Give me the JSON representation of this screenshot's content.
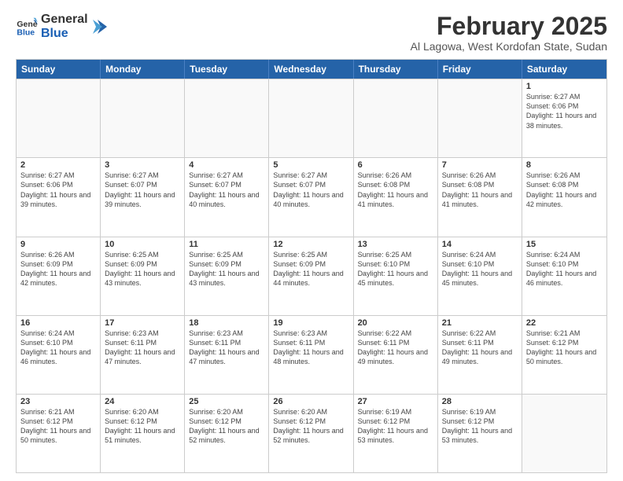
{
  "logo": {
    "line1": "General",
    "line2": "Blue"
  },
  "title": "February 2025",
  "subtitle": "Al Lagowa, West Kordofan State, Sudan",
  "header": {
    "days": [
      "Sunday",
      "Monday",
      "Tuesday",
      "Wednesday",
      "Thursday",
      "Friday",
      "Saturday"
    ]
  },
  "weeks": [
    [
      {
        "day": "",
        "text": ""
      },
      {
        "day": "",
        "text": ""
      },
      {
        "day": "",
        "text": ""
      },
      {
        "day": "",
        "text": ""
      },
      {
        "day": "",
        "text": ""
      },
      {
        "day": "",
        "text": ""
      },
      {
        "day": "1",
        "text": "Sunrise: 6:27 AM\nSunset: 6:06 PM\nDaylight: 11 hours and 38 minutes."
      }
    ],
    [
      {
        "day": "2",
        "text": "Sunrise: 6:27 AM\nSunset: 6:06 PM\nDaylight: 11 hours and 39 minutes."
      },
      {
        "day": "3",
        "text": "Sunrise: 6:27 AM\nSunset: 6:07 PM\nDaylight: 11 hours and 39 minutes."
      },
      {
        "day": "4",
        "text": "Sunrise: 6:27 AM\nSunset: 6:07 PM\nDaylight: 11 hours and 40 minutes."
      },
      {
        "day": "5",
        "text": "Sunrise: 6:27 AM\nSunset: 6:07 PM\nDaylight: 11 hours and 40 minutes."
      },
      {
        "day": "6",
        "text": "Sunrise: 6:26 AM\nSunset: 6:08 PM\nDaylight: 11 hours and 41 minutes."
      },
      {
        "day": "7",
        "text": "Sunrise: 6:26 AM\nSunset: 6:08 PM\nDaylight: 11 hours and 41 minutes."
      },
      {
        "day": "8",
        "text": "Sunrise: 6:26 AM\nSunset: 6:08 PM\nDaylight: 11 hours and 42 minutes."
      }
    ],
    [
      {
        "day": "9",
        "text": "Sunrise: 6:26 AM\nSunset: 6:09 PM\nDaylight: 11 hours and 42 minutes."
      },
      {
        "day": "10",
        "text": "Sunrise: 6:25 AM\nSunset: 6:09 PM\nDaylight: 11 hours and 43 minutes."
      },
      {
        "day": "11",
        "text": "Sunrise: 6:25 AM\nSunset: 6:09 PM\nDaylight: 11 hours and 43 minutes."
      },
      {
        "day": "12",
        "text": "Sunrise: 6:25 AM\nSunset: 6:09 PM\nDaylight: 11 hours and 44 minutes."
      },
      {
        "day": "13",
        "text": "Sunrise: 6:25 AM\nSunset: 6:10 PM\nDaylight: 11 hours and 45 minutes."
      },
      {
        "day": "14",
        "text": "Sunrise: 6:24 AM\nSunset: 6:10 PM\nDaylight: 11 hours and 45 minutes."
      },
      {
        "day": "15",
        "text": "Sunrise: 6:24 AM\nSunset: 6:10 PM\nDaylight: 11 hours and 46 minutes."
      }
    ],
    [
      {
        "day": "16",
        "text": "Sunrise: 6:24 AM\nSunset: 6:10 PM\nDaylight: 11 hours and 46 minutes."
      },
      {
        "day": "17",
        "text": "Sunrise: 6:23 AM\nSunset: 6:11 PM\nDaylight: 11 hours and 47 minutes."
      },
      {
        "day": "18",
        "text": "Sunrise: 6:23 AM\nSunset: 6:11 PM\nDaylight: 11 hours and 47 minutes."
      },
      {
        "day": "19",
        "text": "Sunrise: 6:23 AM\nSunset: 6:11 PM\nDaylight: 11 hours and 48 minutes."
      },
      {
        "day": "20",
        "text": "Sunrise: 6:22 AM\nSunset: 6:11 PM\nDaylight: 11 hours and 49 minutes."
      },
      {
        "day": "21",
        "text": "Sunrise: 6:22 AM\nSunset: 6:11 PM\nDaylight: 11 hours and 49 minutes."
      },
      {
        "day": "22",
        "text": "Sunrise: 6:21 AM\nSunset: 6:12 PM\nDaylight: 11 hours and 50 minutes."
      }
    ],
    [
      {
        "day": "23",
        "text": "Sunrise: 6:21 AM\nSunset: 6:12 PM\nDaylight: 11 hours and 50 minutes."
      },
      {
        "day": "24",
        "text": "Sunrise: 6:20 AM\nSunset: 6:12 PM\nDaylight: 11 hours and 51 minutes."
      },
      {
        "day": "25",
        "text": "Sunrise: 6:20 AM\nSunset: 6:12 PM\nDaylight: 11 hours and 52 minutes."
      },
      {
        "day": "26",
        "text": "Sunrise: 6:20 AM\nSunset: 6:12 PM\nDaylight: 11 hours and 52 minutes."
      },
      {
        "day": "27",
        "text": "Sunrise: 6:19 AM\nSunset: 6:12 PM\nDaylight: 11 hours and 53 minutes."
      },
      {
        "day": "28",
        "text": "Sunrise: 6:19 AM\nSunset: 6:12 PM\nDaylight: 11 hours and 53 minutes."
      },
      {
        "day": "",
        "text": ""
      }
    ]
  ]
}
